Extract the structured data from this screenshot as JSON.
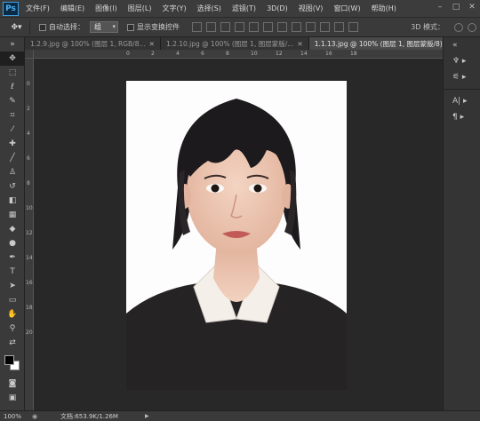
{
  "app": {
    "logo": "Ps"
  },
  "menu": [
    "文件(F)",
    "编辑(E)",
    "图像(I)",
    "图层(L)",
    "文字(Y)",
    "选择(S)",
    "滤镜(T)",
    "3D(D)",
    "视图(V)",
    "窗口(W)",
    "帮助(H)"
  ],
  "window_controls": {
    "minimize": "–",
    "maximize": "□",
    "close": "✕"
  },
  "options": {
    "auto_select_label": "自动选择：",
    "auto_select_value": "组",
    "show_transform_label": "显示变换控件",
    "mode_3d_label": "3D 模式："
  },
  "tabs": [
    {
      "label": "1.2.9.jpg @ 100% (图层 1, RGB/8...",
      "close": "✕"
    },
    {
      "label": "1.2.10.jpg @ 100% (图层 1, 图层蒙版/...",
      "close": "✕"
    },
    {
      "label": "1.1.13.jpg @ 100% (图层 1, 图层蒙版/8) *",
      "close": "✕"
    }
  ],
  "ruler_h": [
    "0",
    "2",
    "4",
    "6",
    "8",
    "10",
    "12",
    "14",
    "16",
    "18"
  ],
  "ruler_v": [
    "0",
    "2",
    "4",
    "6",
    "8",
    "10",
    "12",
    "14",
    "16",
    "18",
    "20"
  ],
  "status": {
    "zoom": "100%",
    "docinfo": "文档:653.9K/1.26M",
    "arrow": "▶"
  },
  "colors": {
    "foreground": "#000000",
    "background": "#ffffff"
  }
}
